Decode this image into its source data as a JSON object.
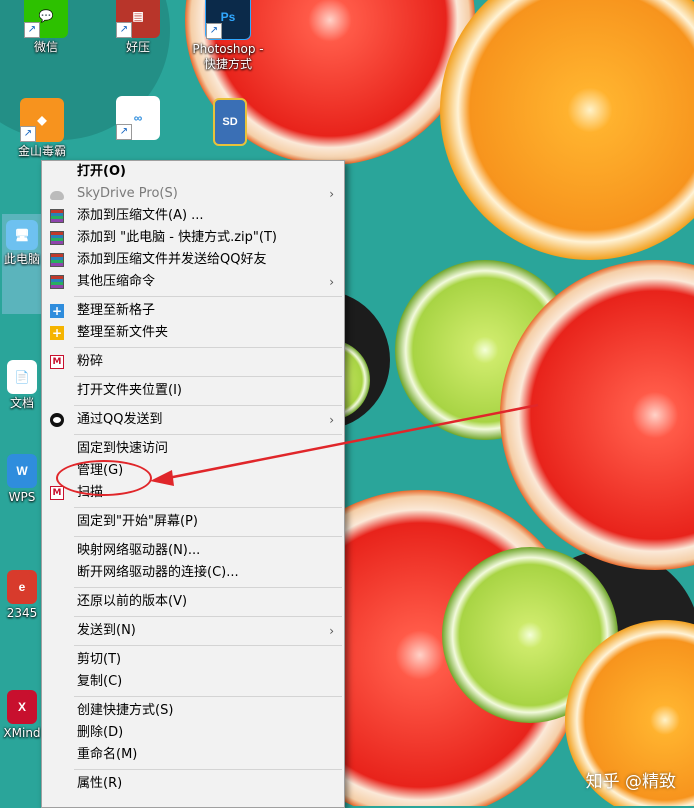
{
  "desktop": {
    "icons": [
      {
        "label": "微信",
        "glyph": "💬",
        "color": "#2dc100"
      },
      {
        "label": "好压",
        "glyph": "▤",
        "color": "#b8352a"
      },
      {
        "label": "Photoshop - 快捷方式",
        "glyph": "Ps",
        "color": "#0b2a4a"
      },
      {
        "label": "金山毒霸",
        "glyph": "◆",
        "color": "#f7931e"
      },
      {
        "label": "",
        "glyph": "∞",
        "color": "#ffffff"
      },
      {
        "label": "",
        "glyph": "SD",
        "color": "#3a6fb5"
      },
      {
        "label": "此电脑",
        "glyph": "🖥",
        "color": "#6ec1f0"
      },
      {
        "label": "文档",
        "glyph": "📄",
        "color": "#ffffff"
      },
      {
        "label": "WPS",
        "glyph": "W",
        "color": "#2f8ddd"
      },
      {
        "label": "2345",
        "glyph": "e",
        "color": "#d83b2c"
      },
      {
        "label": "XMind",
        "glyph": "X",
        "color": "#c8102e"
      }
    ]
  },
  "context_menu": {
    "items": [
      {
        "type": "item",
        "label": "打开(O)",
        "bold": true,
        "icon": ""
      },
      {
        "type": "item",
        "label": "SkyDrive Pro(S)",
        "disabled": true,
        "icon": "cloud-icon",
        "submenu": true
      },
      {
        "type": "item",
        "label": "添加到压缩文件(A) ...",
        "icon": "archive-icon"
      },
      {
        "type": "item",
        "label": "添加到 \"此电脑 - 快捷方式.zip\"(T)",
        "icon": "archive-icon"
      },
      {
        "type": "item",
        "label": "添加到压缩文件并发送给QQ好友",
        "icon": "archive-icon"
      },
      {
        "type": "item",
        "label": "其他压缩命令",
        "icon": "archive-icon",
        "submenu": true
      },
      {
        "type": "sep"
      },
      {
        "type": "item",
        "label": "整理至新格子",
        "icon": "grid-plus-icon"
      },
      {
        "type": "item",
        "label": "整理至新文件夹",
        "icon": "folder-plus-icon"
      },
      {
        "type": "sep"
      },
      {
        "type": "item",
        "label": "粉碎",
        "icon": "mcafee-icon"
      },
      {
        "type": "sep"
      },
      {
        "type": "item",
        "label": "打开文件夹位置(I)",
        "icon": ""
      },
      {
        "type": "sep"
      },
      {
        "type": "item",
        "label": "通过QQ发送到",
        "icon": "qq-icon",
        "submenu": true
      },
      {
        "type": "sep"
      },
      {
        "type": "item",
        "label": "固定到快速访问",
        "icon": ""
      },
      {
        "type": "item",
        "label": "管理(G)",
        "icon": ""
      },
      {
        "type": "item",
        "label": "扫描",
        "icon": "mcafee-icon"
      },
      {
        "type": "sep"
      },
      {
        "type": "item",
        "label": "固定到\"开始\"屏幕(P)",
        "icon": ""
      },
      {
        "type": "sep"
      },
      {
        "type": "item",
        "label": "映射网络驱动器(N)...",
        "icon": ""
      },
      {
        "type": "item",
        "label": "断开网络驱动器的连接(C)...",
        "icon": ""
      },
      {
        "type": "sep"
      },
      {
        "type": "item",
        "label": "还原以前的版本(V)",
        "icon": ""
      },
      {
        "type": "sep"
      },
      {
        "type": "item",
        "label": "发送到(N)",
        "icon": "",
        "submenu": true
      },
      {
        "type": "sep"
      },
      {
        "type": "item",
        "label": "剪切(T)",
        "icon": ""
      },
      {
        "type": "item",
        "label": "复制(C)",
        "icon": ""
      },
      {
        "type": "sep"
      },
      {
        "type": "item",
        "label": "创建快捷方式(S)",
        "icon": ""
      },
      {
        "type": "item",
        "label": "删除(D)",
        "icon": ""
      },
      {
        "type": "item",
        "label": "重命名(M)",
        "icon": ""
      },
      {
        "type": "sep"
      },
      {
        "type": "item",
        "label": "属性(R)",
        "icon": ""
      }
    ],
    "submenu_glyph": "›",
    "highlight_item": "管理(G)"
  },
  "annotation": {
    "color": "#e0262a"
  },
  "watermark": {
    "text": "知乎 @精致"
  },
  "colors": {
    "teal_background": "#2aa59a",
    "grapefruit": "#ef3b2d",
    "orange": "#f7941d",
    "lime": "#9ccc3c"
  }
}
